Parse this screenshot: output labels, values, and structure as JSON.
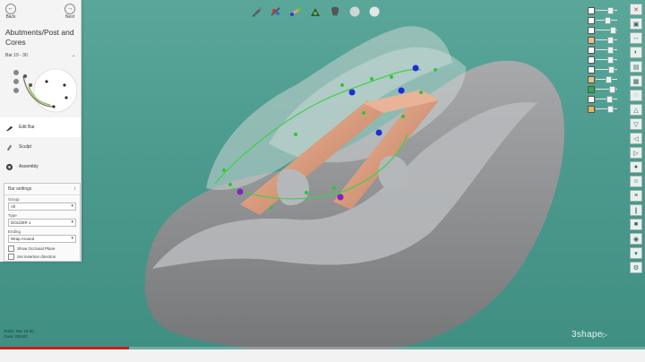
{
  "window": {
    "title": "Abutments/Post and Cores"
  },
  "nav": {
    "back_label": "Back",
    "next_label": "Next"
  },
  "bar": {
    "label": "Bar 19 - 30"
  },
  "tools": [
    {
      "label": "Edit Bar",
      "icon": "edit-bar-icon",
      "active": true
    },
    {
      "label": "Sculpt",
      "icon": "sculpt-icon",
      "active": false
    },
    {
      "label": "Assembly",
      "icon": "assembly-icon",
      "active": false
    }
  ],
  "settings": {
    "title": "Bar settings",
    "group_label": "Group",
    "group_value": "All",
    "type_label": "Type",
    "type_value": "DOLDER 1",
    "ending_label": "Ending",
    "ending_value": "Wrap Around",
    "show_occlusal": "Show Occlusal Plane",
    "set_insertion": "Set insertion direction"
  },
  "status": {
    "line1": "Order: Bar 19-30",
    "line2": "Case: DEMO"
  },
  "logo": {
    "text": "3shape"
  },
  "progress": {
    "fraction": 0.2
  },
  "toolbar": {
    "icons": [
      "scan-tool-icon",
      "toothbrush-tool-icon",
      "implant-tool-icon",
      "gingiva-tool-icon",
      "tooth-dark-icon",
      "tooth-light-icon",
      "tooth-faded-icon"
    ]
  },
  "sliders": [
    {
      "name": "opacity-slider-1",
      "level": 0.7,
      "swatch": "#ffffff"
    },
    {
      "name": "opacity-slider-2",
      "level": 0.55,
      "swatch": "#ffffff"
    },
    {
      "name": "opacity-slider-3",
      "level": 0.85,
      "swatch": "#ffffff"
    },
    {
      "name": "opacity-slider-4",
      "level": 0.7,
      "swatch": "#e8c08a"
    },
    {
      "name": "opacity-slider-5",
      "level": 0.7,
      "swatch": "#ffffff"
    },
    {
      "name": "opacity-slider-6",
      "level": 0.7,
      "swatch": "#ffffff"
    },
    {
      "name": "opacity-slider-7",
      "level": 0.75,
      "swatch": "#ffffff"
    },
    {
      "name": "opacity-slider-8",
      "level": 0.6,
      "swatch": "#e8c08a"
    },
    {
      "name": "opacity-slider-9",
      "level": 0.8,
      "swatch": "#2fa84f"
    },
    {
      "name": "opacity-slider-10",
      "level": 0.65,
      "swatch": "#ffffff"
    },
    {
      "name": "opacity-slider-11",
      "level": 0.7,
      "swatch": "#e6b45a"
    }
  ],
  "right_tools": [
    "close-icon",
    "cube-icon",
    "measure-icon",
    "contours-icon",
    "section-icon",
    "grid-icon",
    "transparency-icon",
    "view-front-icon",
    "view-back-icon",
    "view-left-icon",
    "view-right-icon",
    "tooth-color-icon",
    "face-icon",
    "layers-icon",
    "ruler-icon",
    "camera-icon",
    "capture-icon",
    "chevron-down-icon",
    "settings-icon"
  ],
  "colors": {
    "background": "#4b9a8d",
    "bar": "#d9a07f",
    "point_green": "#34c23a",
    "point_blue": "#1a2fd6",
    "point_purple": "#8a1fc4",
    "accent_red": "#cc1d1d"
  }
}
